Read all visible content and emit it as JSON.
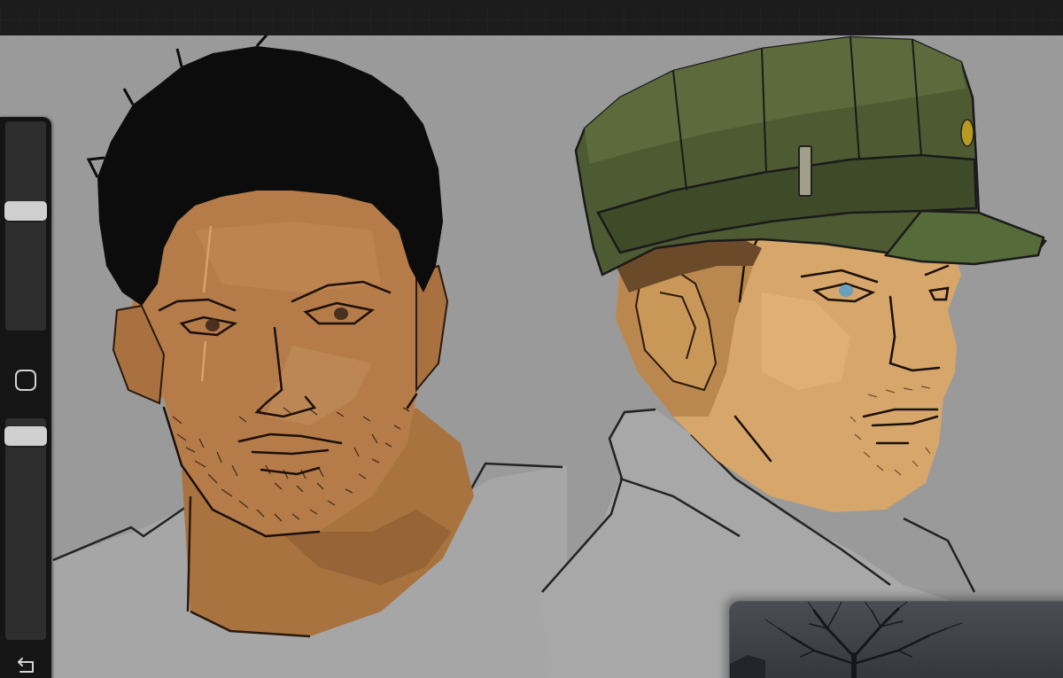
{
  "app": {
    "canvas_color": "#9a9a9a",
    "toolbar_color": "#1c1c1c",
    "sidebar_color": "#151515"
  },
  "sidebar": {
    "brush_size_level": 0.58,
    "brush_opacity_level": 0.96,
    "modify_icon": "square-outline-icon",
    "undo_icon": "undo-arrow-icon"
  },
  "artwork": {
    "subjects": [
      "man-dark-hair",
      "man-military-cap"
    ],
    "skin_color": "#b57c49",
    "hair_color": "#0c0c0c",
    "cap_color": "#4d5a32",
    "shirt_color": "#a8a8a8",
    "eye_color_right": "#6a9fc0"
  },
  "reference_panel": {
    "image": "bare-tree-photo"
  }
}
